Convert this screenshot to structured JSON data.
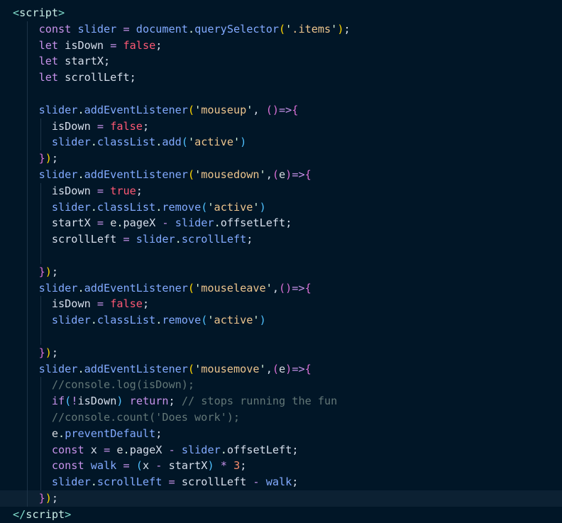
{
  "editor": {
    "language": "html",
    "theme_colors": {
      "background": "#011627",
      "current_line": "#0c2133",
      "indent_guide": "#1d3347"
    },
    "lines": [
      [
        [
          "tk-tag",
          "<"
        ],
        [
          "tk-tagname",
          "script"
        ],
        [
          "tk-tag",
          ">"
        ]
      ],
      [
        [
          "tk-plain",
          "    "
        ],
        [
          "tk-kw",
          "const"
        ],
        [
          "tk-plain",
          " "
        ],
        [
          "tk-var",
          "slider"
        ],
        [
          "tk-plain",
          " "
        ],
        [
          "tk-op",
          "="
        ],
        [
          "tk-plain",
          " "
        ],
        [
          "tk-var",
          "document"
        ],
        [
          "tk-punct",
          "."
        ],
        [
          "tk-fn",
          "querySelector"
        ],
        [
          "tk-paren1",
          "("
        ],
        [
          "tk-punct",
          "'"
        ],
        [
          "tk-str",
          ".items"
        ],
        [
          "tk-punct",
          "'"
        ],
        [
          "tk-paren1",
          ")"
        ],
        [
          "tk-semi",
          ";"
        ]
      ],
      [
        [
          "tk-plain",
          "    "
        ],
        [
          "tk-kw",
          "let"
        ],
        [
          "tk-plain",
          " "
        ],
        [
          "tk-plain",
          "isDown"
        ],
        [
          "tk-plain",
          " "
        ],
        [
          "tk-op",
          "="
        ],
        [
          "tk-plain",
          " "
        ],
        [
          "tk-bool",
          "false"
        ],
        [
          "tk-semi",
          ";"
        ]
      ],
      [
        [
          "tk-plain",
          "    "
        ],
        [
          "tk-kw",
          "let"
        ],
        [
          "tk-plain",
          " "
        ],
        [
          "tk-plain",
          "startX"
        ],
        [
          "tk-semi",
          ";"
        ]
      ],
      [
        [
          "tk-plain",
          "    "
        ],
        [
          "tk-kw",
          "let"
        ],
        [
          "tk-plain",
          " "
        ],
        [
          "tk-plain",
          "scrollLeft"
        ],
        [
          "tk-semi",
          ";"
        ]
      ],
      [],
      [
        [
          "tk-plain",
          "    "
        ],
        [
          "tk-var",
          "slider"
        ],
        [
          "tk-punct",
          "."
        ],
        [
          "tk-fn",
          "addEventListener"
        ],
        [
          "tk-paren1",
          "("
        ],
        [
          "tk-punct",
          "'"
        ],
        [
          "tk-str",
          "mouseup"
        ],
        [
          "tk-punct",
          "'"
        ],
        [
          "tk-plain",
          ", "
        ],
        [
          "tk-paren2",
          "()"
        ],
        [
          "tk-op",
          "=>"
        ],
        [
          "tk-paren2",
          "{"
        ]
      ],
      [
        [
          "tk-plain",
          "      "
        ],
        [
          "tk-plain",
          "isDown"
        ],
        [
          "tk-plain",
          " "
        ],
        [
          "tk-op",
          "="
        ],
        [
          "tk-plain",
          " "
        ],
        [
          "tk-bool",
          "false"
        ],
        [
          "tk-semi",
          ";"
        ]
      ],
      [
        [
          "tk-plain",
          "      "
        ],
        [
          "tk-var",
          "slider"
        ],
        [
          "tk-punct",
          "."
        ],
        [
          "tk-var",
          "classList"
        ],
        [
          "tk-punct",
          "."
        ],
        [
          "tk-fn",
          "add"
        ],
        [
          "tk-paren3",
          "("
        ],
        [
          "tk-punct",
          "'"
        ],
        [
          "tk-str",
          "active"
        ],
        [
          "tk-punct",
          "'"
        ],
        [
          "tk-paren3",
          ")"
        ]
      ],
      [
        [
          "tk-plain",
          "    "
        ],
        [
          "tk-paren2",
          "}"
        ],
        [
          "tk-paren1",
          ")"
        ],
        [
          "tk-semi",
          ";"
        ]
      ],
      [
        [
          "tk-plain",
          "    "
        ],
        [
          "tk-var",
          "slider"
        ],
        [
          "tk-punct",
          "."
        ],
        [
          "tk-fn",
          "addEventListener"
        ],
        [
          "tk-paren1",
          "("
        ],
        [
          "tk-punct",
          "'"
        ],
        [
          "tk-str",
          "mousedown"
        ],
        [
          "tk-punct",
          "'"
        ],
        [
          "tk-plain",
          ","
        ],
        [
          "tk-paren2",
          "("
        ],
        [
          "tk-param",
          "e"
        ],
        [
          "tk-paren2",
          ")"
        ],
        [
          "tk-op",
          "=>"
        ],
        [
          "tk-paren2",
          "{"
        ]
      ],
      [
        [
          "tk-plain",
          "      "
        ],
        [
          "tk-plain",
          "isDown"
        ],
        [
          "tk-plain",
          " "
        ],
        [
          "tk-op",
          "="
        ],
        [
          "tk-plain",
          " "
        ],
        [
          "tk-bool",
          "true"
        ],
        [
          "tk-semi",
          ";"
        ]
      ],
      [
        [
          "tk-plain",
          "      "
        ],
        [
          "tk-var",
          "slider"
        ],
        [
          "tk-punct",
          "."
        ],
        [
          "tk-var",
          "classList"
        ],
        [
          "tk-punct",
          "."
        ],
        [
          "tk-fn",
          "remove"
        ],
        [
          "tk-paren3",
          "("
        ],
        [
          "tk-punct",
          "'"
        ],
        [
          "tk-str",
          "active"
        ],
        [
          "tk-punct",
          "'"
        ],
        [
          "tk-paren3",
          ")"
        ]
      ],
      [
        [
          "tk-plain",
          "      "
        ],
        [
          "tk-plain",
          "startX"
        ],
        [
          "tk-plain",
          " "
        ],
        [
          "tk-op",
          "="
        ],
        [
          "tk-plain",
          " "
        ],
        [
          "tk-param",
          "e"
        ],
        [
          "tk-punct",
          "."
        ],
        [
          "tk-plain",
          "pageX"
        ],
        [
          "tk-plain",
          " "
        ],
        [
          "tk-op",
          "-"
        ],
        [
          "tk-plain",
          " "
        ],
        [
          "tk-var",
          "slider"
        ],
        [
          "tk-punct",
          "."
        ],
        [
          "tk-plain",
          "offsetLeft"
        ],
        [
          "tk-semi",
          ";"
        ]
      ],
      [
        [
          "tk-plain",
          "      "
        ],
        [
          "tk-plain",
          "scrollLeft"
        ],
        [
          "tk-plain",
          " "
        ],
        [
          "tk-op",
          "="
        ],
        [
          "tk-plain",
          " "
        ],
        [
          "tk-var",
          "slider"
        ],
        [
          "tk-punct",
          "."
        ],
        [
          "tk-var",
          "scrollLeft"
        ],
        [
          "tk-semi",
          ";"
        ]
      ],
      [],
      [
        [
          "tk-plain",
          "    "
        ],
        [
          "tk-paren2",
          "}"
        ],
        [
          "tk-paren1",
          ")"
        ],
        [
          "tk-semi",
          ";"
        ]
      ],
      [
        [
          "tk-plain",
          "    "
        ],
        [
          "tk-var",
          "slider"
        ],
        [
          "tk-punct",
          "."
        ],
        [
          "tk-fn",
          "addEventListener"
        ],
        [
          "tk-paren1",
          "("
        ],
        [
          "tk-punct",
          "'"
        ],
        [
          "tk-str",
          "mouseleave"
        ],
        [
          "tk-punct",
          "'"
        ],
        [
          "tk-plain",
          ","
        ],
        [
          "tk-paren2",
          "()"
        ],
        [
          "tk-op",
          "=>"
        ],
        [
          "tk-paren2",
          "{"
        ]
      ],
      [
        [
          "tk-plain",
          "      "
        ],
        [
          "tk-plain",
          "isDown"
        ],
        [
          "tk-plain",
          " "
        ],
        [
          "tk-op",
          "="
        ],
        [
          "tk-plain",
          " "
        ],
        [
          "tk-bool",
          "false"
        ],
        [
          "tk-semi",
          ";"
        ]
      ],
      [
        [
          "tk-plain",
          "      "
        ],
        [
          "tk-var",
          "slider"
        ],
        [
          "tk-punct",
          "."
        ],
        [
          "tk-var",
          "classList"
        ],
        [
          "tk-punct",
          "."
        ],
        [
          "tk-fn",
          "remove"
        ],
        [
          "tk-paren3",
          "("
        ],
        [
          "tk-punct",
          "'"
        ],
        [
          "tk-str",
          "active"
        ],
        [
          "tk-punct",
          "'"
        ],
        [
          "tk-paren3",
          ")"
        ]
      ],
      [],
      [
        [
          "tk-plain",
          "    "
        ],
        [
          "tk-paren2",
          "}"
        ],
        [
          "tk-paren1",
          ")"
        ],
        [
          "tk-semi",
          ";"
        ]
      ],
      [
        [
          "tk-plain",
          "    "
        ],
        [
          "tk-var",
          "slider"
        ],
        [
          "tk-punct",
          "."
        ],
        [
          "tk-fn",
          "addEventListener"
        ],
        [
          "tk-paren1",
          "("
        ],
        [
          "tk-punct",
          "'"
        ],
        [
          "tk-str",
          "mousemove"
        ],
        [
          "tk-punct",
          "'"
        ],
        [
          "tk-plain",
          ","
        ],
        [
          "tk-paren2",
          "("
        ],
        [
          "tk-param",
          "e"
        ],
        [
          "tk-paren2",
          ")"
        ],
        [
          "tk-op",
          "=>"
        ],
        [
          "tk-paren2",
          "{"
        ]
      ],
      [
        [
          "tk-plain",
          "      "
        ],
        [
          "tk-comment",
          "//console.log(isDown);"
        ]
      ],
      [
        [
          "tk-plain",
          "      "
        ],
        [
          "tk-ctrl",
          "if"
        ],
        [
          "tk-paren3",
          "("
        ],
        [
          "tk-op",
          "!"
        ],
        [
          "tk-plain",
          "isDown"
        ],
        [
          "tk-paren3",
          ")"
        ],
        [
          "tk-plain",
          " "
        ],
        [
          "tk-ctrl",
          "return"
        ],
        [
          "tk-semi",
          ";"
        ],
        [
          "tk-plain",
          " "
        ],
        [
          "tk-comment",
          "// stops running the fun"
        ]
      ],
      [
        [
          "tk-plain",
          "      "
        ],
        [
          "tk-comment",
          "//console.count('Does work');"
        ]
      ],
      [
        [
          "tk-plain",
          "      "
        ],
        [
          "tk-param",
          "e"
        ],
        [
          "tk-punct",
          "."
        ],
        [
          "tk-fn",
          "preventDefault"
        ],
        [
          "tk-semi",
          ";"
        ]
      ],
      [
        [
          "tk-plain",
          "      "
        ],
        [
          "tk-kw",
          "const"
        ],
        [
          "tk-plain",
          " "
        ],
        [
          "tk-plain",
          "x"
        ],
        [
          "tk-plain",
          " "
        ],
        [
          "tk-op",
          "="
        ],
        [
          "tk-plain",
          " "
        ],
        [
          "tk-param",
          "e"
        ],
        [
          "tk-punct",
          "."
        ],
        [
          "tk-plain",
          "pageX"
        ],
        [
          "tk-plain",
          " "
        ],
        [
          "tk-op",
          "-"
        ],
        [
          "tk-plain",
          " "
        ],
        [
          "tk-var",
          "slider"
        ],
        [
          "tk-punct",
          "."
        ],
        [
          "tk-plain",
          "offsetLeft"
        ],
        [
          "tk-semi",
          ";"
        ]
      ],
      [
        [
          "tk-plain",
          "      "
        ],
        [
          "tk-kw",
          "const"
        ],
        [
          "tk-plain",
          " "
        ],
        [
          "tk-var",
          "walk"
        ],
        [
          "tk-plain",
          " "
        ],
        [
          "tk-op",
          "="
        ],
        [
          "tk-plain",
          " "
        ],
        [
          "tk-paren3",
          "("
        ],
        [
          "tk-plain",
          "x"
        ],
        [
          "tk-plain",
          " "
        ],
        [
          "tk-op",
          "-"
        ],
        [
          "tk-plain",
          " "
        ],
        [
          "tk-plain",
          "startX"
        ],
        [
          "tk-paren3",
          ")"
        ],
        [
          "tk-plain",
          " "
        ],
        [
          "tk-op",
          "*"
        ],
        [
          "tk-plain",
          " "
        ],
        [
          "tk-num",
          "3"
        ],
        [
          "tk-semi",
          ";"
        ]
      ],
      [
        [
          "tk-plain",
          "      "
        ],
        [
          "tk-var",
          "slider"
        ],
        [
          "tk-punct",
          "."
        ],
        [
          "tk-var",
          "scrollLeft"
        ],
        [
          "tk-plain",
          " "
        ],
        [
          "tk-op",
          "="
        ],
        [
          "tk-plain",
          " "
        ],
        [
          "tk-plain",
          "scrollLeft"
        ],
        [
          "tk-plain",
          " "
        ],
        [
          "tk-op",
          "-"
        ],
        [
          "tk-plain",
          " "
        ],
        [
          "tk-var",
          "walk"
        ],
        [
          "tk-semi",
          ";"
        ]
      ],
      [
        [
          "tk-plain",
          "    "
        ],
        [
          "tk-paren2",
          "}"
        ],
        [
          "tk-paren1",
          ")"
        ],
        [
          "tk-semi",
          ";"
        ]
      ],
      [
        [
          "tk-tag",
          "</"
        ],
        [
          "tk-tagname",
          "script"
        ],
        [
          "tk-tag",
          ">"
        ]
      ]
    ],
    "current_line_index": 30
  }
}
